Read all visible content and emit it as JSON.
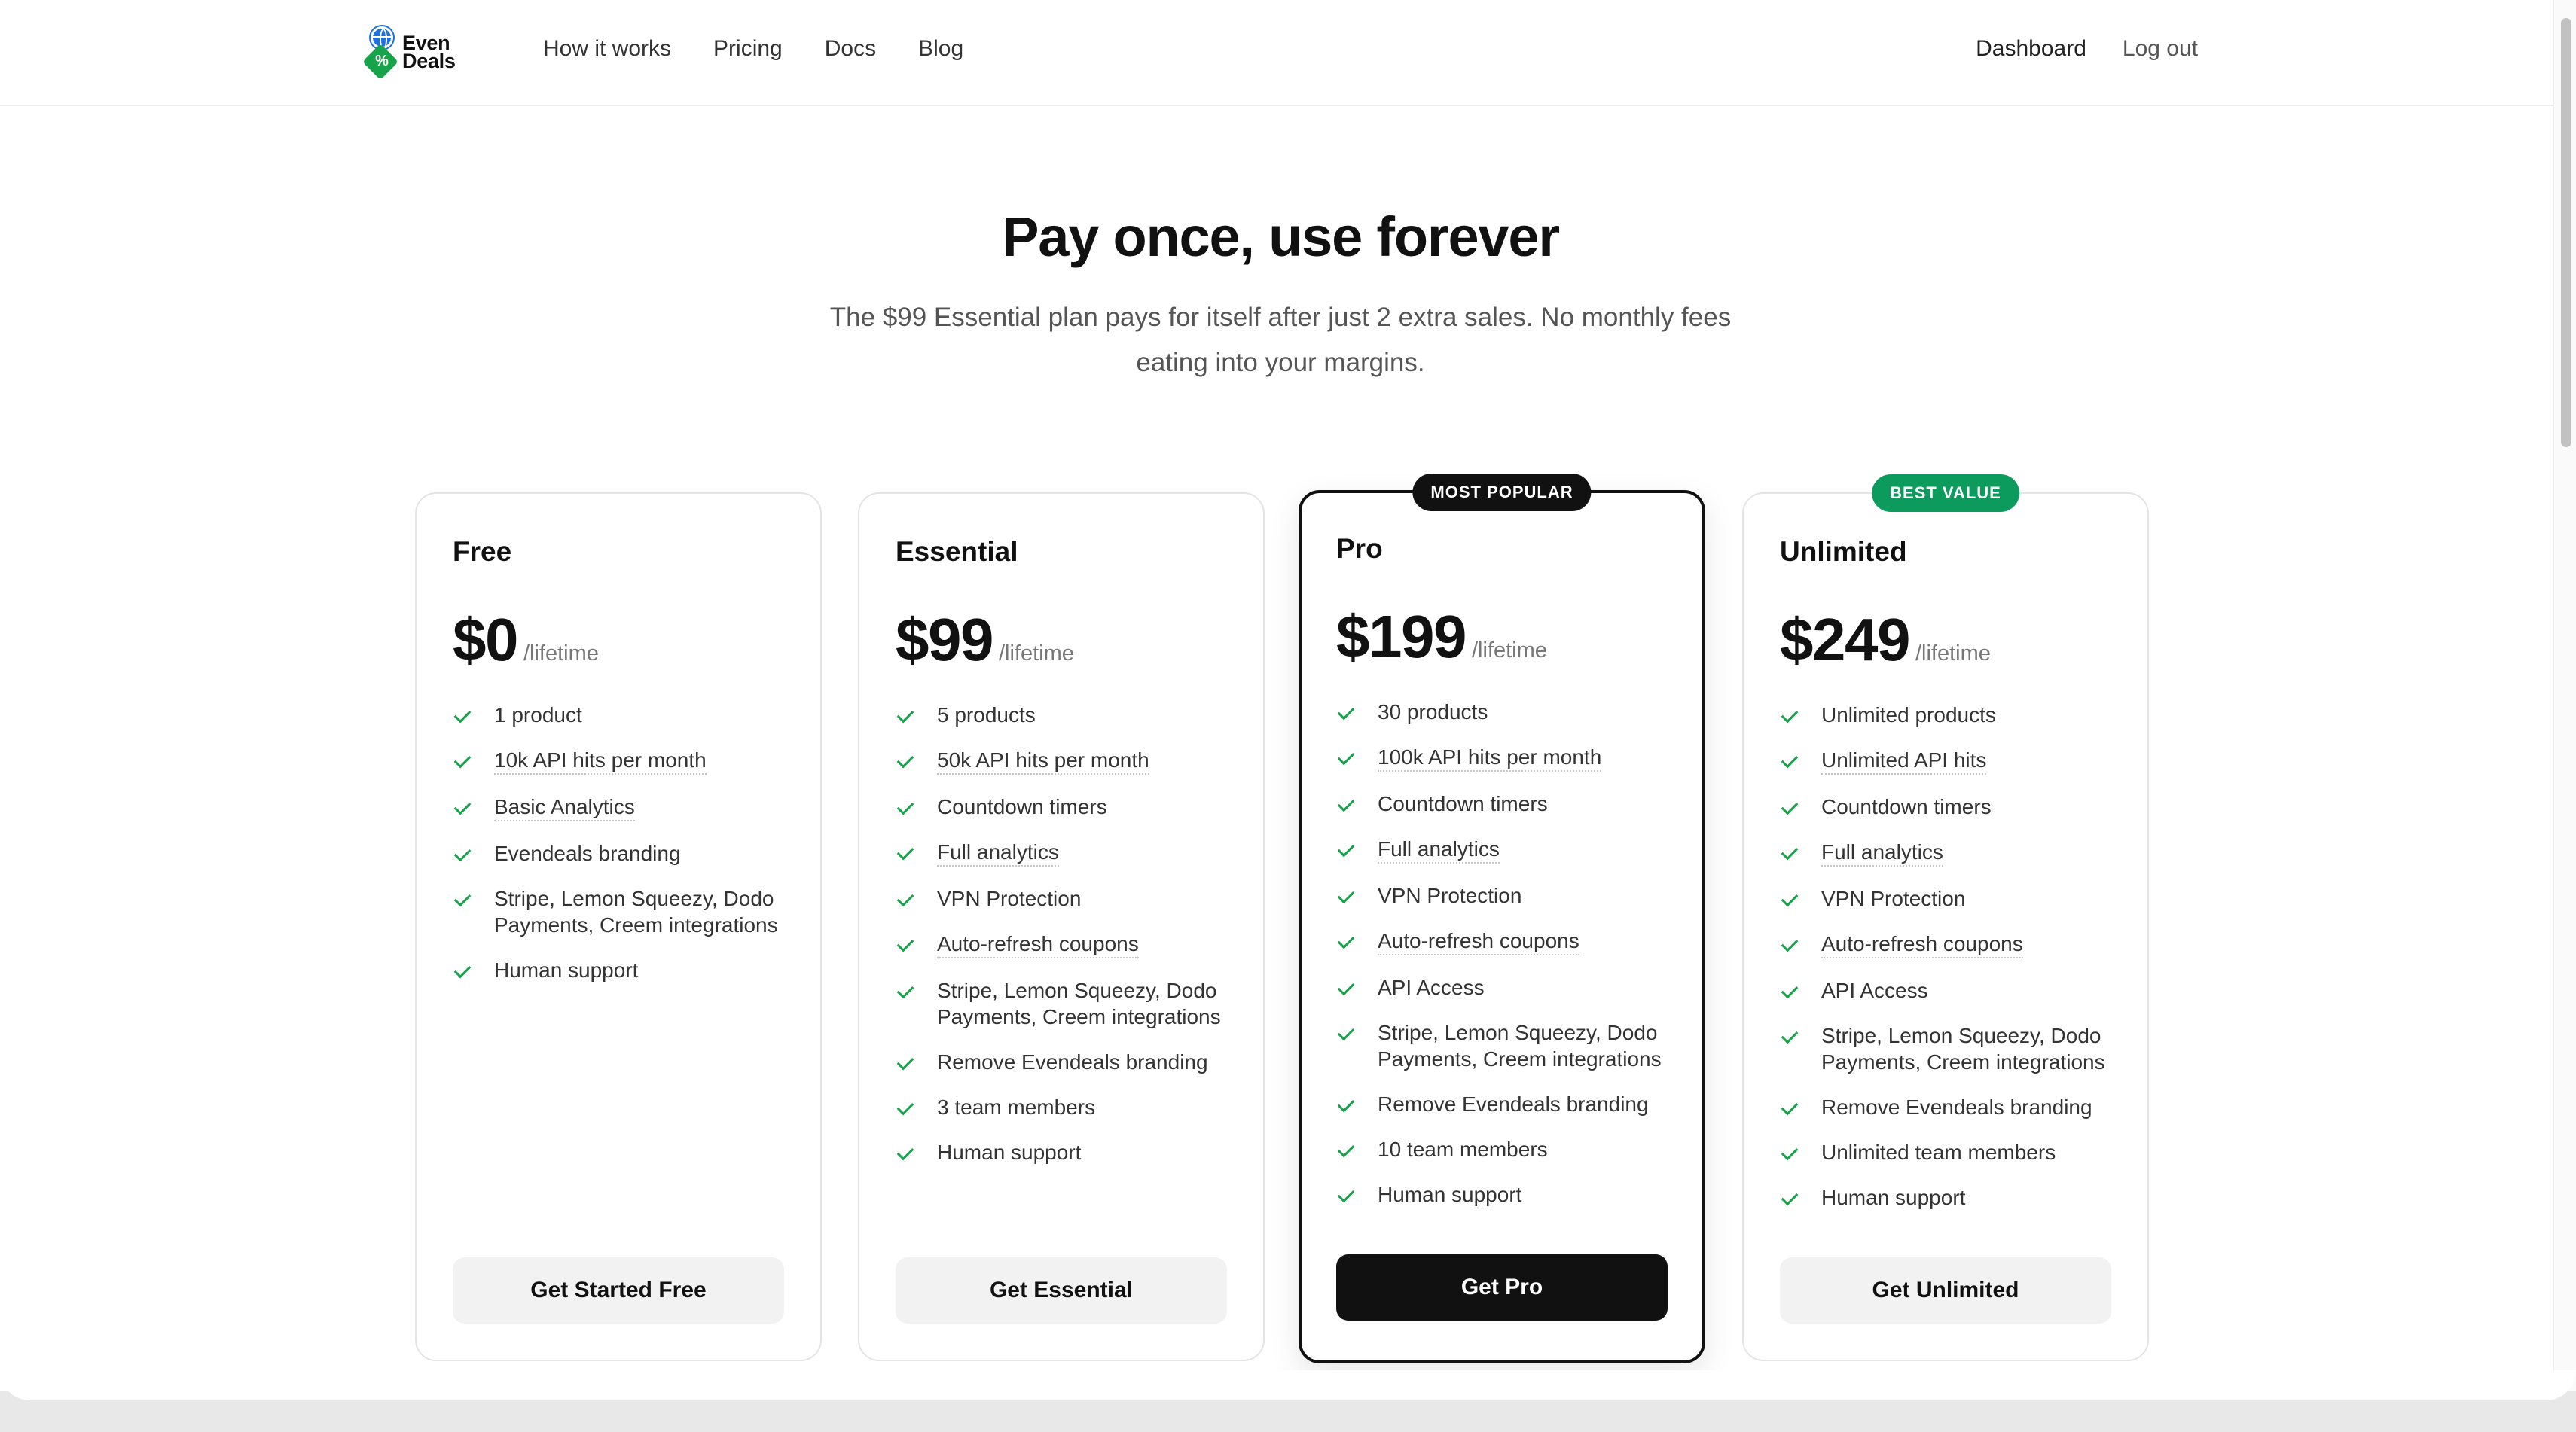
{
  "nav": {
    "logo_line1": "Even",
    "logo_line2": "Deals",
    "links": [
      "How it works",
      "Pricing",
      "Docs",
      "Blog"
    ],
    "dashboard": "Dashboard",
    "logout": "Log out"
  },
  "hero": {
    "title": "Pay once, use forever",
    "subtitle": "The $99 Essential plan pays for itself after just 2 extra sales. No monthly fees eating into your margins."
  },
  "plans": [
    {
      "name": "Free",
      "price": "$0",
      "period": "/lifetime",
      "features": [
        "1 product",
        "10k API hits per month",
        "Basic Analytics",
        "Evendeals branding",
        "Stripe, Lemon Squeezy, Dodo Payments, Creem integrations",
        "Human support"
      ],
      "cta": "Get Started Free"
    },
    {
      "name": "Essential",
      "price": "$99",
      "period": "/lifetime",
      "features": [
        "5 products",
        "50k API hits per month",
        "Countdown timers",
        "Full analytics",
        "VPN Protection",
        "Auto-refresh coupons",
        "Stripe, Lemon Squeezy, Dodo Payments, Creem integrations",
        "Remove Evendeals branding",
        "3 team members",
        "Human support"
      ],
      "cta": "Get Essential"
    },
    {
      "name": "Pro",
      "badge": "MOST POPULAR",
      "price": "$199",
      "period": "/lifetime",
      "features": [
        "30 products",
        "100k API hits per month",
        "Countdown timers",
        "Full analytics",
        "VPN Protection",
        "Auto-refresh coupons",
        "API Access",
        "Stripe, Lemon Squeezy, Dodo Payments, Creem integrations",
        "Remove Evendeals branding",
        "10 team members",
        "Human support"
      ],
      "cta": "Get Pro"
    },
    {
      "name": "Unlimited",
      "badge": "BEST VALUE",
      "price": "$249",
      "period": "/lifetime",
      "features": [
        "Unlimited products",
        "Unlimited API hits",
        "Countdown timers",
        "Full analytics",
        "VPN Protection",
        "Auto-refresh coupons",
        "API Access",
        "Stripe, Lemon Squeezy, Dodo Payments, Creem integrations",
        "Remove Evendeals branding",
        "Unlimited team members",
        "Human support"
      ],
      "cta": "Get Unlimited"
    }
  ],
  "colors": {
    "accent_green": "#16a34a",
    "badge_green": "#0d9b5d",
    "dark": "#111111"
  }
}
